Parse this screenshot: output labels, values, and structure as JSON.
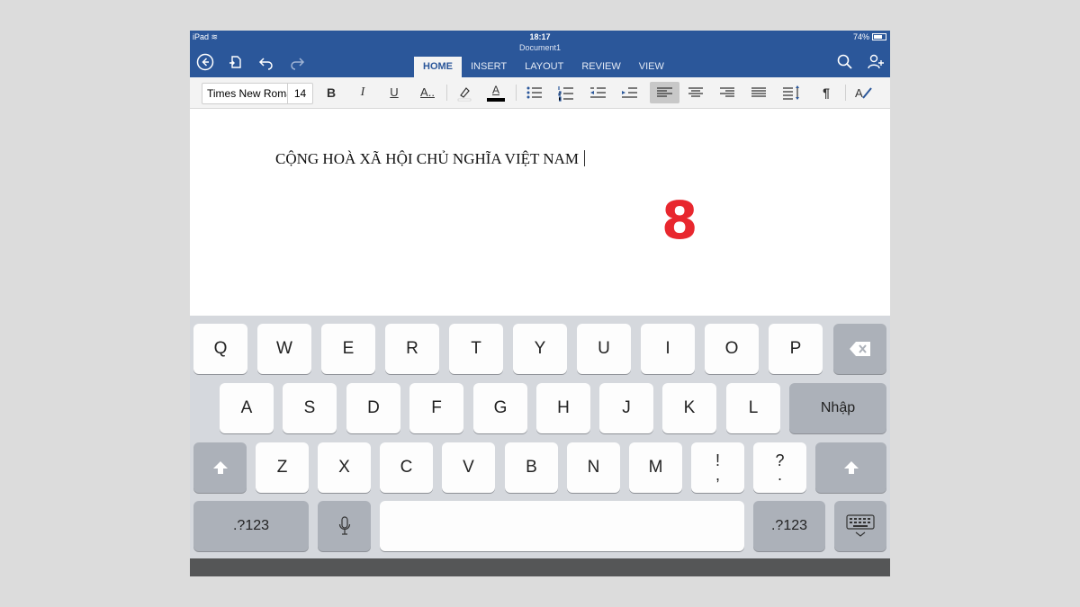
{
  "status": {
    "device": "iPad",
    "time": "18:17",
    "battery": "74%"
  },
  "document_title": "Document1",
  "toolbar": {
    "back_icon": "back-circle-icon",
    "file_icon": "file-save-icon",
    "undo_icon": "undo-icon",
    "redo_icon": "redo-icon",
    "search_icon": "search-icon",
    "share_icon": "add-person-icon"
  },
  "tabs": [
    "HOME",
    "INSERT",
    "LAYOUT",
    "REVIEW",
    "VIEW"
  ],
  "active_tab": "HOME",
  "ribbon": {
    "font_name": "Times New Roman",
    "font_size": "14",
    "bold": "B",
    "italic": "I",
    "underline": "U",
    "font_effects": "A..",
    "font_color_letter": "A",
    "paragraph_mark": "¶"
  },
  "document": {
    "text": "CỘNG HOÀ XÃ HỘI CHỦ NGHĨA VIỆT NAM",
    "step_label": "8"
  },
  "keyboard": {
    "row1": [
      "Q",
      "W",
      "E",
      "R",
      "T",
      "Y",
      "U",
      "I",
      "O",
      "P"
    ],
    "row2": [
      "A",
      "S",
      "D",
      "F",
      "G",
      "H",
      "J",
      "K",
      "L"
    ],
    "enter_label": "Nhập",
    "row3": [
      "Z",
      "X",
      "C",
      "V",
      "B",
      "N",
      "M"
    ],
    "punct1": [
      "!",
      ","
    ],
    "punct2": [
      "?",
      "."
    ],
    "numbers_label": ".?123"
  },
  "colors": {
    "brand_blue": "#2b579a",
    "step_red": "#e8272e"
  }
}
